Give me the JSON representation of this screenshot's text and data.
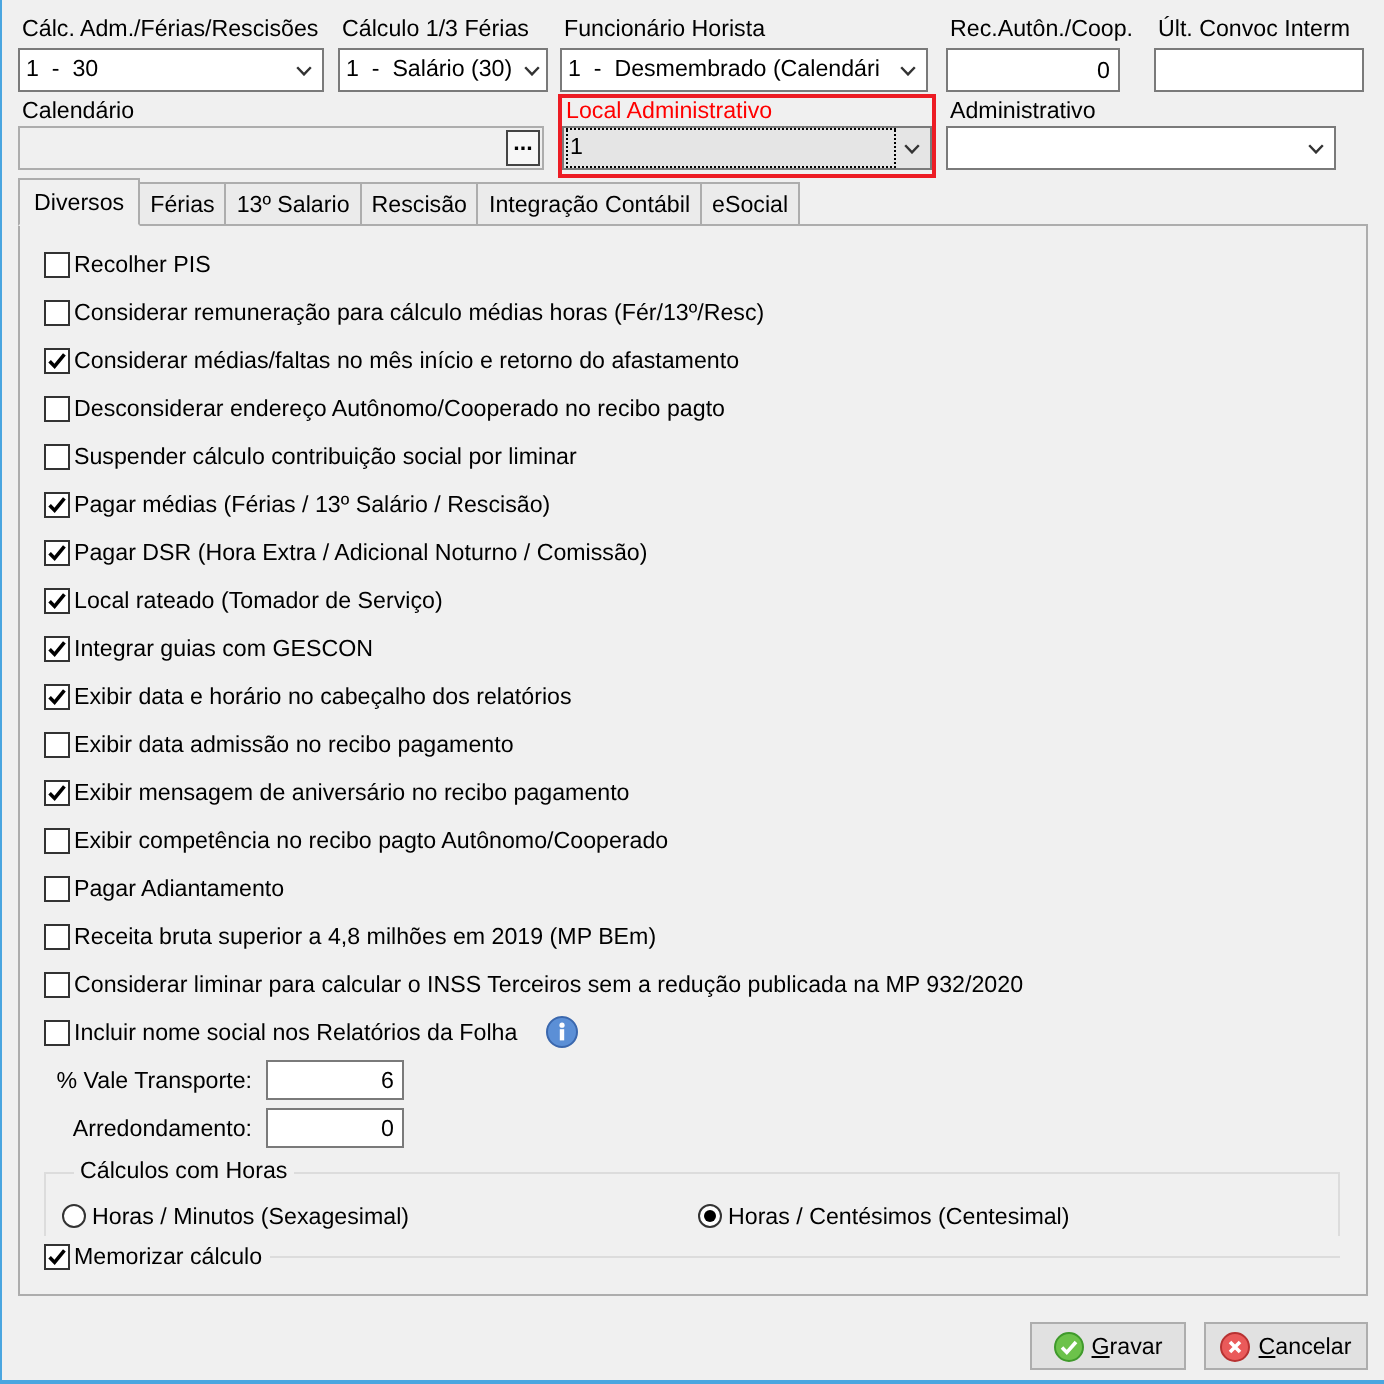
{
  "top_fields": [
    {
      "kind": "select",
      "label": "Cálc. Adm./Férias/Rescisões",
      "value": "1  -  30"
    },
    {
      "kind": "select",
      "label": "Cálculo 1/3 Férias",
      "value": "1  -  Salário (30)"
    },
    {
      "kind": "select",
      "label": "Funcionário Horista",
      "value": "1  -  Desmembrado (Calendári"
    },
    {
      "kind": "number",
      "label": "Rec.Autôn./Coop.",
      "value": "0"
    },
    {
      "kind": "text",
      "label": "Últ. Convoc Interm"
    }
  ],
  "lookup_fields": [
    {
      "kind": "lookup",
      "label": "Calendário",
      "button": "...",
      "disabled": true,
      "focused": false,
      "highlighted": false
    },
    {
      "kind": "select",
      "label": "Local Administrativo",
      "value": "1",
      "disabled": false,
      "focused": true,
      "highlighted": true
    },
    {
      "kind": "select",
      "label": "Administrativo",
      "disabled": false,
      "focused": false,
      "highlighted": false
    }
  ],
  "tabs": [
    {
      "label": "Diversos",
      "selected": true
    },
    {
      "label": "Férias",
      "selected": false
    },
    {
      "label": "13º Salario",
      "selected": false
    },
    {
      "label": "Rescisão",
      "selected": false
    },
    {
      "label": "Integração Contábil",
      "selected": false
    },
    {
      "label": "eSocial",
      "selected": false
    }
  ],
  "options": [
    {
      "label": "Recolher PIS",
      "checked": false,
      "info": false
    },
    {
      "label": "Considerar remuneração para cálculo médias horas (Fér/13º/Resc)",
      "checked": false,
      "info": false
    },
    {
      "label": "Considerar médias/faltas no mês início e retorno do afastamento",
      "checked": true,
      "info": false
    },
    {
      "label": "Desconsiderar endereço Autônomo/Cooperado no recibo pagto",
      "checked": false,
      "info": false
    },
    {
      "label": "Suspender cálculo contribuição social por liminar",
      "checked": false,
      "info": false
    },
    {
      "label": "Pagar médias (Férias / 13º Salário / Rescisão)",
      "checked": true,
      "info": false
    },
    {
      "label": "Pagar DSR (Hora Extra / Adicional Noturno / Comissão)",
      "checked": true,
      "info": false
    },
    {
      "label": "Local rateado (Tomador de Serviço)",
      "checked": true,
      "info": false
    },
    {
      "label": "Integrar guias com GESCON",
      "checked": true,
      "info": false
    },
    {
      "label": "Exibir data e horário no cabeçalho dos relatórios",
      "checked": true,
      "info": false
    },
    {
      "label": "Exibir data admissão no recibo pagamento",
      "checked": false,
      "info": false
    },
    {
      "label": "Exibir mensagem de aniversário no recibo pagamento",
      "checked": true,
      "info": false
    },
    {
      "label": "Exibir competência no recibo pagto Autônomo/Cooperado",
      "checked": false,
      "info": false
    },
    {
      "label": "Pagar Adiantamento",
      "checked": false,
      "info": false
    },
    {
      "label": "Receita bruta superior a 4,8 milhões em 2019 (MP BEm)",
      "checked": false,
      "info": false
    },
    {
      "label": "Considerar liminar para calcular o INSS Terceiros sem a redução publicada na MP 932/2020",
      "checked": false,
      "info": false
    },
    {
      "label": "Incluir nome social nos Relatórios da Folha",
      "checked": false,
      "info": true
    }
  ],
  "number_fields": [
    {
      "label": "% Vale Transporte:",
      "value": "6"
    },
    {
      "label": "Arredondamento:",
      "value": "0"
    }
  ],
  "hours_group": {
    "title": "Cálculos com Horas",
    "options": [
      {
        "label": "Horas / Minutos (Sexagesimal)",
        "selected": false
      },
      {
        "label": "Horas / Centésimos (Centesimal)",
        "selected": true
      }
    ]
  },
  "memorize": {
    "label": "Memorizar cálculo",
    "checked": true
  },
  "buttons": [
    {
      "kind": "save",
      "label": "Gravar"
    },
    {
      "kind": "cancel",
      "label": "Cancelar"
    }
  ]
}
